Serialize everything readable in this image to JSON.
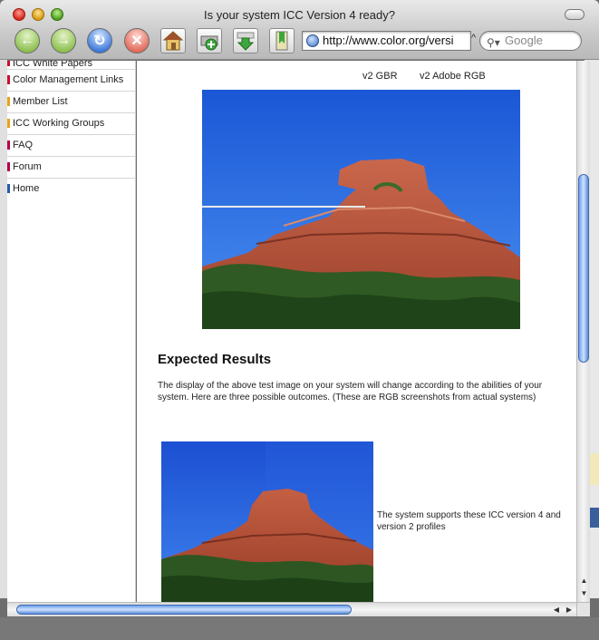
{
  "window": {
    "title": "Is your system ICC Version 4 ready?"
  },
  "toolbar": {
    "back_icon": "back-arrow-icon",
    "forward_icon": "forward-arrow-icon",
    "reload_icon": "reload-icon",
    "stop_icon": "stop-icon",
    "home_icon": "home-icon",
    "add_bookmark_icon": "add-bookmark-icon",
    "downloads_icon": "downloads-icon",
    "bookmarks_icon": "bookmarks-icon",
    "url": "http://www.color.org/versi",
    "search_placeholder": "Google"
  },
  "sidebar": {
    "items": [
      {
        "label": "ICC White Papers",
        "color": "#c8102e"
      },
      {
        "label": "Color Management Links",
        "color": "#c8102e"
      },
      {
        "label": "Member List",
        "color": "#e8a317"
      },
      {
        "label": "ICC Working Groups",
        "color": "#e8a317"
      },
      {
        "label": "FAQ",
        "color": "#b5004f"
      },
      {
        "label": "Forum",
        "color": "#b5004f"
      },
      {
        "label": "Home",
        "color": "#2a5aa8"
      }
    ]
  },
  "main": {
    "caption_left": "v2 GBR",
    "caption_right": "v2 Adobe RGB",
    "heading": "Expected Results",
    "paragraph": "The display of the above test image on your system will change according to the abilities of your system. Here are three possible outcomes. (These are RGB screenshots from actual systems)",
    "outcome_text": "The system supports these ICC version 4 and version 2 profiles"
  },
  "colors": {
    "sky": "#2c6ee0",
    "rock": "#b6513a",
    "scrollbar_accent": "#6ea0e8"
  }
}
